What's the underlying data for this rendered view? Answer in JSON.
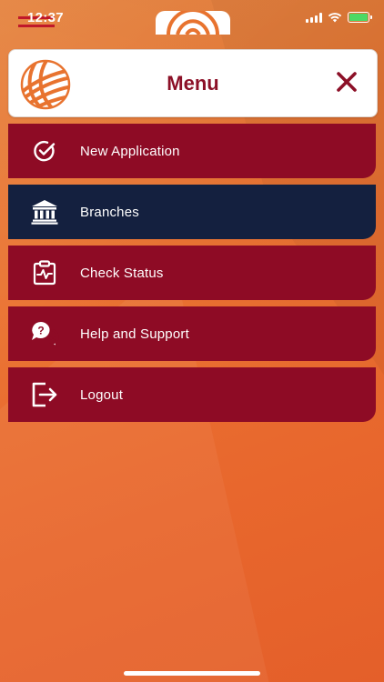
{
  "status_bar": {
    "time": "12:37",
    "battery_color": "#4cd964"
  },
  "header": {
    "title": "Menu",
    "logo_icon": "globe-logo-icon",
    "close_icon": "close-icon"
  },
  "colors": {
    "background": "#ec7434",
    "item_background": "#8e0b25",
    "active_item_background": "#14203f",
    "title_color": "#8c1027"
  },
  "menu": {
    "items": [
      {
        "label": "New Application",
        "icon": "check-circle-icon",
        "active": false
      },
      {
        "label": "Branches",
        "icon": "bank-icon",
        "active": true
      },
      {
        "label": "Check Status",
        "icon": "clipboard-pulse-icon",
        "active": false
      },
      {
        "label": "Help and Support",
        "icon": "chat-question-icon",
        "active": false
      },
      {
        "label": "Logout",
        "icon": "logout-icon",
        "active": false
      }
    ]
  }
}
